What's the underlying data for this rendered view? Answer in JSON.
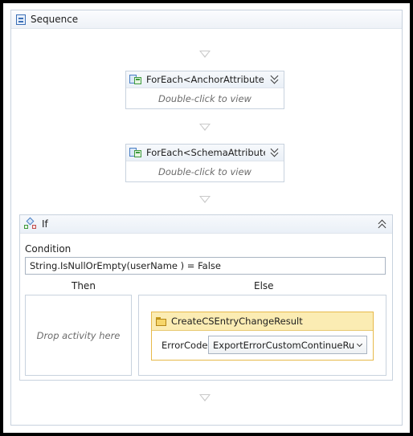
{
  "sequence": {
    "title": "Sequence",
    "icon": "sequence-icon"
  },
  "activities": [
    {
      "title": "ForEach<AnchorAttribute>",
      "hint": "Double-click to view",
      "icon": "foreach-icon",
      "toggle_icon": "expand-chevron-icon"
    },
    {
      "title": "ForEach<SchemaAttribute>",
      "hint": "Double-click to view",
      "icon": "foreach-icon",
      "toggle_icon": "expand-chevron-icon"
    }
  ],
  "if_block": {
    "title": "If",
    "icon": "if-icon",
    "toggle_icon": "collapse-chevron-icon",
    "condition_label": "Condition",
    "condition_value": "String.IsNullOrEmpty(userName ) = False",
    "then_label": "Then",
    "else_label": "Else",
    "then_placeholder": "Drop activity here",
    "else_activity": {
      "title": "CreateCSEntryChangeResult",
      "icon": "activity-icon",
      "field_label": "ErrorCode",
      "field_value": "ExportErrorCustomContinueRun"
    }
  },
  "colors": {
    "header_gradient": "#eaf0f7",
    "border": "#c8d2de",
    "activity_highlight": "#fbecb3",
    "connector_arrow": "#c9c9c9"
  }
}
